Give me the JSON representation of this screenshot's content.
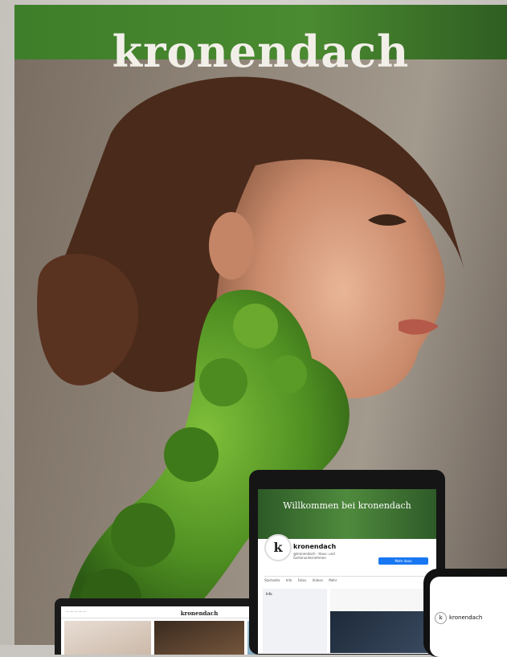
{
  "poster": {
    "title": "kronendach"
  },
  "tablet": {
    "banner_text": "Willkommen bei kronendach",
    "avatar_letter": "k",
    "page_name": "kronendach",
    "page_subtitle": "@kronendach · Haus- und Gartenunternehmen",
    "button_label": "Mehr dazu",
    "tabs": [
      "Startseite",
      "Info",
      "Fotos",
      "Videos",
      "Mehr"
    ],
    "info_label": "Info"
  },
  "laptop": {
    "logo": "kronendach"
  },
  "phone": {
    "avatar_letter": "k",
    "account_name": "kronendach"
  },
  "colors": {
    "brand_green": "#3e7e2a",
    "facebook_blue": "#1877f2"
  }
}
